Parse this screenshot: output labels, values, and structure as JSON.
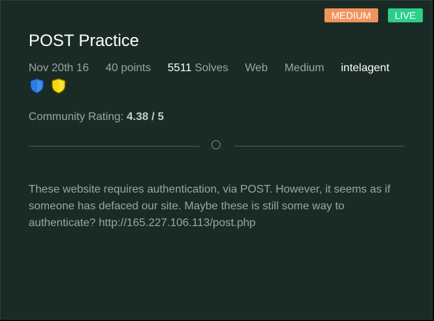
{
  "badges": {
    "difficulty": "MEDIUM",
    "status": "LIVE"
  },
  "challenge": {
    "title": "POST Practice",
    "date": "Nov 20th 16",
    "points": "40 points",
    "solves_count": "5511",
    "solves_label": "Solves",
    "category": "Web",
    "difficulty": "Medium",
    "author": "intelagent",
    "author_badges": [
      "blue-shield-icon",
      "yellow-shield-icon"
    ]
  },
  "rating": {
    "label": "Community Rating:",
    "value": "4.38 / 5"
  },
  "description": "These website requires authentication, via POST. However, it seems as if someone has defaced our site. Maybe these is still some way to authenticate? http://165.227.106.113/post.php",
  "colors": {
    "card_bg": "#1a2b26",
    "medium_badge": "#f0935c",
    "live_badge": "#2bcf8a",
    "blue_shield": "#2a7de1",
    "yellow_shield": "#f5d90a"
  }
}
